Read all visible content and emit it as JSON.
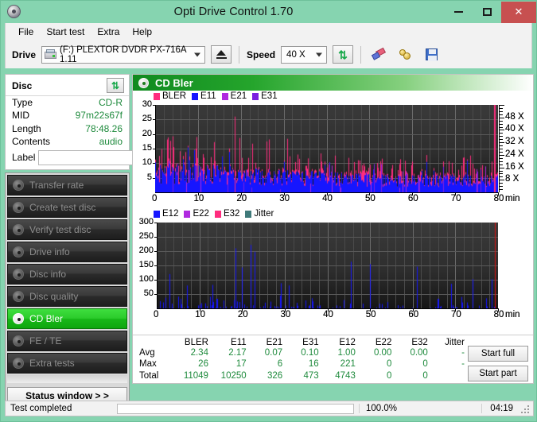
{
  "window": {
    "title": "Opti Drive Control 1.70",
    "app_icon": "disc-icon",
    "minimize_label": "–",
    "maximize_label": "□",
    "close_label": "✕"
  },
  "menu": {
    "items": [
      "File",
      "Start test",
      "Extra",
      "Help"
    ]
  },
  "toolbar": {
    "drive_label": "Drive",
    "drive_value": "(F:)  PLEXTOR DVDR  PX-716A 1.11",
    "eject_label": "eject-icon",
    "speed_label": "Speed",
    "speed_value": "40 X",
    "refresh_label": "refresh-icon",
    "erase_label": "erase-icon",
    "bookmark_label": "gold-discs-icon",
    "save_label": "save-icon"
  },
  "disc_panel": {
    "title": "Disc",
    "refresh_icon": "refresh-icon",
    "rows": [
      {
        "key": "Type",
        "value": "CD-R"
      },
      {
        "key": "MID",
        "value": "97m22s67f"
      },
      {
        "key": "Length",
        "value": "78:48.26"
      },
      {
        "key": "Contents",
        "value": "audio"
      }
    ],
    "label_key": "Label",
    "label_value": "",
    "label_placeholder": "",
    "label_button_icon": "cd-icon"
  },
  "nav": {
    "items": [
      {
        "label": "Transfer rate",
        "active": false
      },
      {
        "label": "Create test disc",
        "active": false
      },
      {
        "label": "Verify test disc",
        "active": false
      },
      {
        "label": "Drive info",
        "active": false
      },
      {
        "label": "Disc info",
        "active": false
      },
      {
        "label": "Disc quality",
        "active": false
      },
      {
        "label": "CD Bler",
        "active": true
      },
      {
        "label": "FE / TE",
        "active": false
      },
      {
        "label": "Extra tests",
        "active": false
      }
    ],
    "status_window_label": "Status window > >"
  },
  "main": {
    "header_title": "CD Bler",
    "header_icon": "disc-icon"
  },
  "chart_data": [
    {
      "type": "line",
      "title": "CD Bler",
      "xlabel": "min",
      "ylabel": "",
      "xlim": [
        0,
        80
      ],
      "ylim": [
        0,
        30
      ],
      "xticks": [
        0,
        10,
        20,
        30,
        40,
        50,
        60,
        70,
        80
      ],
      "yticks": [
        5,
        10,
        15,
        20,
        25,
        30
      ],
      "right_axis_label": "X",
      "right_ticks": [
        "8 X",
        "16 X",
        "24 X",
        "32 X",
        "40 X",
        "48 X"
      ],
      "right_tick_values": [
        8,
        16,
        24,
        32,
        40,
        48
      ],
      "grid": true,
      "legend_position": "top-left",
      "legend": [
        {
          "name": "BLER",
          "color": "#ff2d7e"
        },
        {
          "name": "E11",
          "color": "#1616ff"
        },
        {
          "name": "E21",
          "color": "#b02ae0"
        },
        {
          "name": "E31",
          "color": "#7a1fe0"
        }
      ],
      "series": [
        {
          "name": "BLER",
          "color": "#ff2d7e",
          "avg": 2.34,
          "max": 26,
          "total": 11049
        },
        {
          "name": "E11",
          "color": "#1616ff",
          "avg": 2.17,
          "max": 17,
          "total": 10250
        },
        {
          "name": "E21",
          "color": "#b02ae0",
          "avg": 0.07,
          "max": 6,
          "total": 326
        },
        {
          "name": "E31",
          "color": "#7a1fe0",
          "avg": 0.1,
          "max": 16,
          "total": 473
        }
      ]
    },
    {
      "type": "line",
      "title": "",
      "xlabel": "min",
      "ylabel": "",
      "xlim": [
        0,
        80
      ],
      "ylim": [
        0,
        300
      ],
      "xticks": [
        0,
        10,
        20,
        30,
        40,
        50,
        60,
        70,
        80
      ],
      "yticks": [
        50,
        100,
        150,
        200,
        250,
        300
      ],
      "grid": true,
      "legend_position": "top-left",
      "legend": [
        {
          "name": "E12",
          "color": "#1616ff"
        },
        {
          "name": "E22",
          "color": "#b02ae0"
        },
        {
          "name": "E32",
          "color": "#ff2d7e"
        },
        {
          "name": "Jitter",
          "color": "#3f7a7a"
        }
      ],
      "series": [
        {
          "name": "E12",
          "color": "#1616ff",
          "avg": 1.0,
          "max": 221,
          "total": 4743
        },
        {
          "name": "E22",
          "color": "#b02ae0",
          "avg": 0.0,
          "max": 0,
          "total": 0
        },
        {
          "name": "E32",
          "color": "#ff2d7e",
          "avg": 0.0,
          "max": 0,
          "total": 0
        },
        {
          "name": "Jitter",
          "color": "#3f7a7a",
          "avg": "-",
          "max": "-",
          "total": ""
        }
      ],
      "peaks": [
        {
          "x": 3,
          "y": 120
        },
        {
          "x": 7,
          "y": 80
        },
        {
          "x": 13,
          "y": 82
        },
        {
          "x": 18.5,
          "y": 210
        },
        {
          "x": 20,
          "y": 143
        },
        {
          "x": 22,
          "y": 222
        },
        {
          "x": 23,
          "y": 198
        },
        {
          "x": 29,
          "y": 88
        },
        {
          "x": 31,
          "y": 80
        },
        {
          "x": 45.5,
          "y": 163
        },
        {
          "x": 50,
          "y": 155
        },
        {
          "x": 61,
          "y": 146
        },
        {
          "x": 69,
          "y": 86
        },
        {
          "x": 74,
          "y": 102
        },
        {
          "x": 78.5,
          "y": 102
        }
      ]
    }
  ],
  "stats": {
    "columns": [
      "BLER",
      "E11",
      "E21",
      "E31",
      "E12",
      "E22",
      "E32",
      "Jitter"
    ],
    "rows": [
      {
        "label": "Avg",
        "values": [
          "2.34",
          "2.17",
          "0.07",
          "0.10",
          "1.00",
          "0.00",
          "0.00",
          "-"
        ]
      },
      {
        "label": "Max",
        "values": [
          "26",
          "17",
          "6",
          "16",
          "221",
          "0",
          "0",
          "-"
        ]
      },
      {
        "label": "Total",
        "values": [
          "11049",
          "10250",
          "326",
          "473",
          "4743",
          "0",
          "0",
          ""
        ]
      }
    ],
    "start_full_label": "Start full",
    "start_part_label": "Start part"
  },
  "statusbar": {
    "status_text": "Test completed",
    "progress_percent": "100.0%",
    "progress_value": 100,
    "elapsed": "04:19"
  },
  "colors": {
    "accent_green": "#10a010",
    "window_bg": "#86d4b0",
    "close_red": "#c75050",
    "value_green": "#1e8a3c",
    "bler_pink": "#ff2d7e",
    "e11_blue": "#1616ff"
  }
}
